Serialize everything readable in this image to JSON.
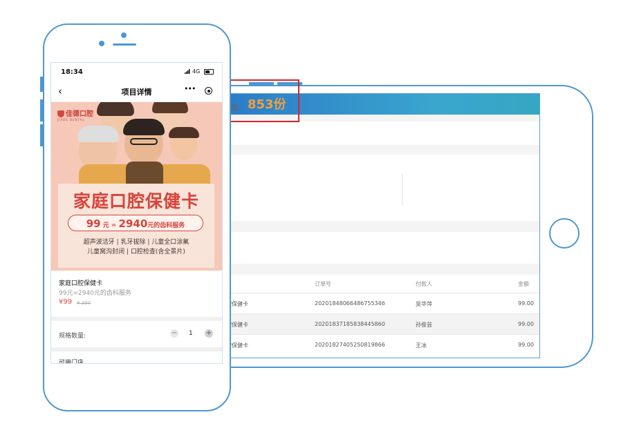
{
  "colors": {
    "device_outline": "#4d97d2",
    "price_red": "#e24c3b",
    "total_orange": "#f2a03b",
    "highlight_red": "#d8232a"
  },
  "tablet": {
    "stat": {
      "label": "订单总数:",
      "value": "853份"
    },
    "table": {
      "columns": [
        "订单号",
        "付款人",
        "金额"
      ],
      "rows": [
        {
          "product": "腔保健卡",
          "order_no": "20201848066486755346",
          "payer": "吴华萍",
          "amount": "99.00"
        },
        {
          "product": "腔保健卡",
          "order_no": "20201837185838445860",
          "payer": "孙俊芸",
          "amount": "99.00"
        },
        {
          "product": "腔保健卡",
          "order_no": "20201827405250819866",
          "payer": "王冰",
          "amount": "99.00"
        }
      ]
    }
  },
  "phone": {
    "status_bar": {
      "time": "18:34",
      "network": "4G"
    },
    "nav": {
      "back_icon": "chevron-left-icon",
      "title": "项目详情",
      "more_icon": "more-icon",
      "target_icon": "target-icon"
    },
    "banner": {
      "brand_name": "佳德口腔",
      "brand_sub": "JIADE DENTAL",
      "title": "家庭口腔保健卡",
      "price_line": {
        "price": "99",
        "unit1": "元 =",
        "value": "2940",
        "unit2": "元的齿科服务"
      },
      "services_line1": "超声波洁牙 | 乳牙拔除 | 儿童全口涂氟",
      "services_line2": "儿童窝沟封闭 | 口腔检查(含全景片)"
    },
    "product": {
      "name": "家庭口腔保健卡",
      "desc": "99元=2940元的齿科服务",
      "price": "¥99",
      "original_price": "¥ 300"
    },
    "spec": {
      "label": "规格数量:",
      "minus": "−",
      "quantity": "1",
      "plus": "+"
    },
    "stores_label": "可用门店"
  }
}
